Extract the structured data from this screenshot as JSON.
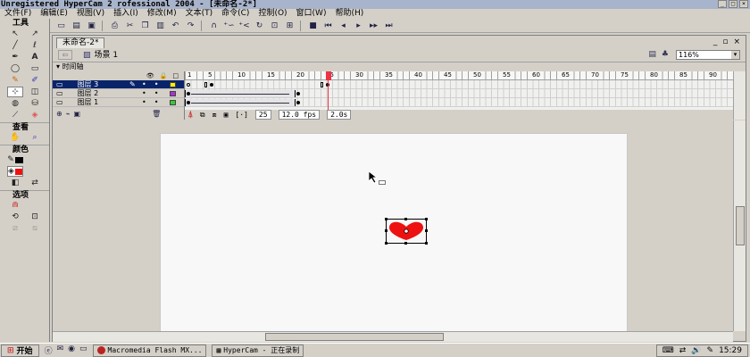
{
  "window": {
    "title": "Unregistered HyperCam 2 rofessional 2004 - [未命名-2*]"
  },
  "menu": [
    "文件(F)",
    "编辑(E)",
    "视图(V)",
    "插入(I)",
    "修改(M)",
    "文本(T)",
    "命令(C)",
    "控制(O)",
    "窗口(W)",
    "帮助(H)"
  ],
  "toolbar": {
    "icons": [
      "new-icon",
      "open-icon",
      "save-icon",
      "print-icon",
      "cut-icon",
      "copy-icon",
      "paste-icon",
      "undo-icon",
      "redo-icon",
      "snap-icon",
      "smooth-icon",
      "straighten-icon",
      "rotate-icon",
      "scale-icon",
      "align-icon",
      "stop-icon",
      "rewind-icon",
      "step-back-icon",
      "play-icon",
      "step-forward-icon",
      "fast-forward-icon"
    ]
  },
  "tools": {
    "header": "工具",
    "view_label": "查看",
    "colors_label": "颜色",
    "options_label": "选项"
  },
  "document": {
    "tab": "未命名-2*",
    "scene": "场景 1",
    "zoom": "116%"
  },
  "timeline": {
    "label": "时间轴",
    "ruler": [
      "1",
      "5",
      "10",
      "15",
      "20",
      "25",
      "30",
      "35",
      "40",
      "45",
      "50",
      "55",
      "60",
      "65",
      "70",
      "75",
      "80",
      "85",
      "90"
    ],
    "layers": [
      {
        "name": "图层 3",
        "color": "#ffee00",
        "active": true
      },
      {
        "name": "图层 2",
        "color": "#aa33cc",
        "active": false
      },
      {
        "name": "图层 1",
        "color": "#33cc33",
        "active": false
      }
    ],
    "current_frame": "25",
    "fps": "12.0 fps",
    "elapsed": "2.0s"
  },
  "taskbar": {
    "start": "开始",
    "tasks": [
      "Macromedia Flash MX...",
      "HyperCam - 正在录制"
    ],
    "clock": "15:29"
  },
  "colors": {
    "stroke": "#000000",
    "fill": "#ee1111",
    "heart": "#ee1111"
  }
}
